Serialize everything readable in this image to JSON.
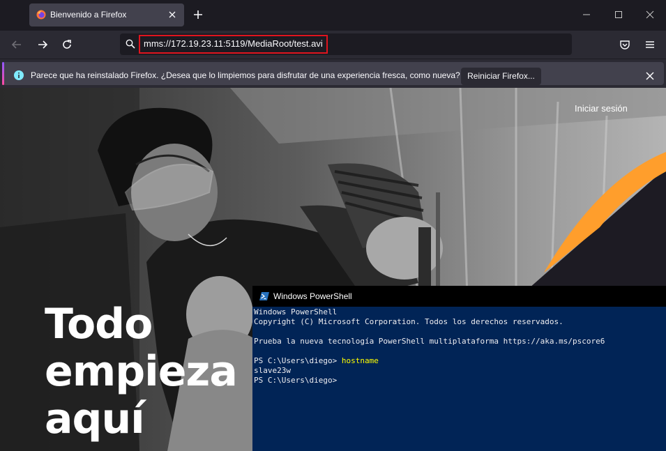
{
  "browser": {
    "tab": {
      "title": "Bienvenido a Firefox"
    },
    "url": "mms://172.19.23.11:5119/MediaRoot/test.avi"
  },
  "notification": {
    "message": "Parece que ha reinstalado Firefox. ¿Desea que lo limpiemos para disfrutar de una experiencia fresca, como nueva?",
    "button_label": "Reiniciar Firefox..."
  },
  "page": {
    "signin": "Iniciar sesión",
    "headline": [
      "Todo",
      "empieza",
      "aquí"
    ]
  },
  "powershell": {
    "title": "Windows PowerShell",
    "lines": {
      "l1": "Windows PowerShell",
      "l2": "Copyright (C) Microsoft Corporation. Todos los derechos reservados.",
      "l3": "",
      "l4": "Prueba la nueva tecnología PowerShell multiplataforma https://aka.ms/pscore6",
      "l5": "",
      "l6_prompt": "PS C:\\Users\\diego> ",
      "l6_cmd": "hostname",
      "l7": "slave23w",
      "l8": "PS C:\\Users\\diego>"
    }
  },
  "colors": {
    "highlight": "#e0141e",
    "orange_accent": "#ff9e2c",
    "ps_background": "#012456",
    "ps_command": "#ffff00"
  }
}
